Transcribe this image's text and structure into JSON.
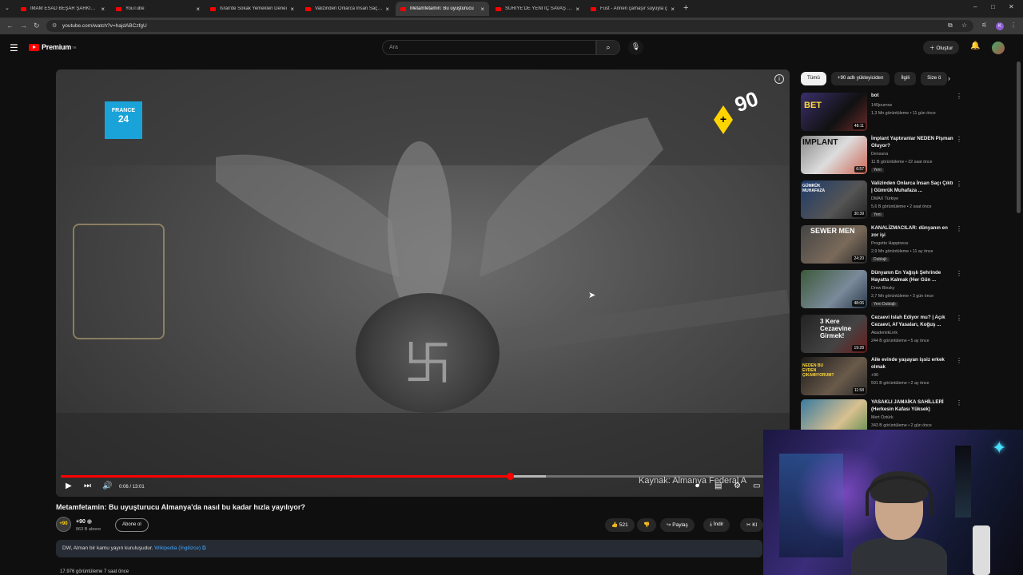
{
  "browser": {
    "tabs": [
      {
        "title": "İMAM ESAD BEŞAR ŞARKISI - Yo",
        "active": false
      },
      {
        "title": "YouTube",
        "active": false
      },
      {
        "title": "İsrail'de Sokak Yemekleri Deneı",
        "active": false
      },
      {
        "title": "Valizinden Onlarca İnsan Saçı Ç",
        "active": false
      },
      {
        "title": "Metamfetamin: Bu uyuşturucu",
        "active": true
      },
      {
        "title": "SURİYE'DE YENİ İÇ SAVAŞ - You",
        "active": false
      },
      {
        "title": "Fust - Annen çamaşır suyuyla ç",
        "active": false
      }
    ],
    "new_tab_symbol": "+",
    "window_controls": [
      "–",
      "□",
      "✕"
    ],
    "url": "youtube.com/watch?v=hajdABCzfgU"
  },
  "header": {
    "logo_text": "Premium",
    "logo_superscript": "TR",
    "search_placeholder": "Ara",
    "create_label": "Oluştur"
  },
  "player": {
    "channel_bug_top": "FRANCE",
    "channel_bug_bottom": "24",
    "badge_text": "90",
    "time_label": "0:06 / 13:01",
    "progress_fraction": 0.62,
    "buffer_fraction": 0.67,
    "source_caption": "Kaynak: Almanya Federal A"
  },
  "video": {
    "title": "Metamfetamin: Bu uyuşturucu Almanya'da nasıl bu kadar hızla yayılıyor?",
    "channel_name": "+90",
    "channel_avatar": "+90",
    "subscribers": "863 B abone",
    "subscribe_label": "Abone ol",
    "likes": "521",
    "share_label": "Paylaş",
    "download_label": "İndir",
    "clip_label": "Kl",
    "info_text": "DW, Alman bir kamu yayın kuruluşudur.",
    "info_link": "Wikipedia (İngilizce)",
    "views_line": "17.976 görüntüleme  7 saat önce"
  },
  "sidebar": {
    "chips": [
      "Tümü",
      "+90 adlı yükleyiciden",
      "İlgili",
      "Size ö"
    ],
    "items": [
      {
        "title": "bot",
        "channel": "140journos",
        "meta": "1,3 Mn görüntüleme • 11 gün önce",
        "duration": "48:11",
        "tag": ""
      },
      {
        "title": "İmplant Yaptıranlar NEDEN Pişman Oluyor?",
        "channel": "Densuna",
        "meta": "11 B görüntüleme • 22 saat önce",
        "duration": "6:57",
        "tag": "Yeni"
      },
      {
        "title": "Valizinden Onlarca İnsan Saçı Çıktı | Gümrük Muhafaza ...",
        "channel": "DMAX Türkiye",
        "meta": "5,6 B görüntüleme • 2 saat önce",
        "duration": "30:39",
        "tag": "Yeni"
      },
      {
        "title": "KANALİZMACILAR: dünyanın en zor işi",
        "channel": "Progetto Happiness",
        "meta": "2,9 Mn görüntüleme • 11 ay önce",
        "duration": "24:20",
        "tag": "Dublajlı"
      },
      {
        "title": "Dünyanın En Yağışlı Şehrinde Hayatta Kalmak (Her Gün ...",
        "channel": "Drew Binsky",
        "meta": "2,7 Mn görüntüleme • 3 gün önce",
        "duration": "48:06",
        "tag": "Yeni  Dublajlı"
      },
      {
        "title": "Cezaevi Islah Ediyor mu? | Açık Cezaevi, Af Yasaları, Koğuş ...",
        "channel": "AkademikLink",
        "meta": "244 B görüntüleme • 5 ay önce",
        "duration": "19:28",
        "tag": ""
      },
      {
        "title": "Aile evinde yaşayan işsiz erkek olmak",
        "channel": "+90",
        "meta": "591 B görüntüleme • 2 ay önce",
        "duration": "11:58",
        "tag": ""
      },
      {
        "title": "YASAKLI JAMAİKA SAHİLLERİ (Herkesin Kafası Yüksek)",
        "channel": "Mert Öztürk",
        "meta": "343 B görüntüleme • 2 gün önce",
        "duration": "",
        "tag": ""
      }
    ],
    "thumb_captions": [
      "BET",
      "IMPLANT",
      "GÜMRÜK MUHAFAZA",
      "SEWER MEN",
      "",
      "3 Kere Cezaevine Girmek!",
      "NEDEN BU EVDEN ÇIKAMIYORUM?",
      ""
    ]
  },
  "colors": {
    "accent_red": "#ff0000",
    "background": "#0f0f0f",
    "link_blue": "#3ea6ff"
  }
}
